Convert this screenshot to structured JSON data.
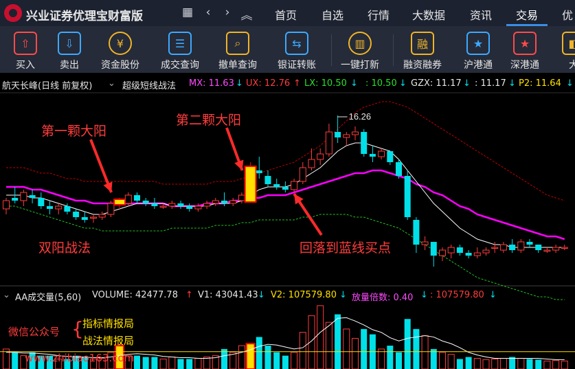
{
  "app": {
    "title": "兴业证券优理宝财富版"
  },
  "nav": {
    "grid_icon": "▦",
    "back_icon": "‹",
    "forward_icon": "›",
    "up_icon": "︽"
  },
  "menu": [
    "首页",
    "自选",
    "行情",
    "大数据",
    "资讯",
    "交易",
    "优"
  ],
  "toolbar": [
    {
      "label": "买入",
      "icon": "buy-icon",
      "glyph": "⇧",
      "color": "#ff4a4a"
    },
    {
      "label": "卖出",
      "icon": "sell-icon",
      "glyph": "⇩",
      "color": "#3da9ff"
    },
    {
      "label": "资金股份",
      "icon": "yuan-coin-icon",
      "glyph": "¥",
      "color": "#f0b429"
    },
    {
      "label": "成交查询",
      "icon": "list-icon",
      "glyph": "☰",
      "color": "#3da9ff"
    },
    {
      "label": "撤单查询",
      "icon": "search-doc-icon",
      "glyph": "⌕",
      "color": "#f0b429"
    },
    {
      "label": "银证转账",
      "icon": "transfer-icon",
      "glyph": "⇆",
      "color": "#3da9ff"
    },
    {
      "label": "一键打新",
      "icon": "new-stock-icon",
      "glyph": "▥",
      "color": "#f0b429"
    },
    {
      "label": "融资融券",
      "icon": "margin-icon",
      "glyph": "融",
      "color": "#f0b429"
    },
    {
      "label": "沪港通",
      "icon": "sh-hk-connect-icon",
      "glyph": "★",
      "color": "#3da9ff"
    },
    {
      "label": "深港通",
      "icon": "sz-hk-connect-icon",
      "glyph": "★",
      "color": "#ff4a4a"
    },
    {
      "label": "大",
      "icon": "more-icon",
      "glyph": "◧",
      "color": "#f0b429"
    }
  ],
  "info": {
    "stock": "航天长峰(日线 前复权)",
    "formula": "超级短线战法",
    "mx_label": "MX: 11.63",
    "mx_arrow": "↓",
    "ux_label": "UX: 12.76",
    "ux_arrow": "↑",
    "lx_label": "LX: 10.50",
    "lx_arrow": "↓",
    "c4_label": ": 10.50",
    "c4_arrow": "↓",
    "gzx_label": "GZX: 11.17",
    "gzx_arrow": "↓",
    "c6_label": ": 11.17",
    "c6_arrow": "↓",
    "p2_label": "P2: 11.64",
    "p2_arrow": "↓"
  },
  "annotations": {
    "first": "第一颗大阳",
    "second": "第二颗大阳",
    "strategy": "双阳战法",
    "pullback": "回落到蓝线买点",
    "high_label": "16.26"
  },
  "vol_info": {
    "name": "AA成交量(5,60)",
    "volume": "VOLUME: 42477.78",
    "volume_arrow": "↑",
    "v1": "V1: 43041.43",
    "v1_arrow": "↓",
    "v2": "V2: 107579.80",
    "v2_arrow": "↓",
    "ratio": "放量倍数: 0.40",
    "ratio_arrow": "↓",
    "last": ": 107579.80",
    "last_arrow": "↓"
  },
  "watermark": {
    "wechat": "微信公众号",
    "brace": "{",
    "line1": "指标情报局",
    "line2": "战法情报局",
    "url": "www.zhibiao163.com"
  },
  "colors": {
    "up": "#ff3c3c",
    "down": "#00e0e8",
    "highlight": "#ffe000",
    "ma_white": "#ffffff",
    "ma_magenta": "#ff00ff",
    "band_red": "#c00000",
    "band_green": "#20c020"
  },
  "chart_data": {
    "type": "candlestick",
    "candles": [
      {
        "o": 10.2,
        "h": 10.6,
        "l": 10.0,
        "c": 10.5
      },
      {
        "o": 10.6,
        "h": 11.0,
        "l": 10.4,
        "c": 10.5
      },
      {
        "o": 10.5,
        "h": 10.9,
        "l": 10.3,
        "c": 10.8
      },
      {
        "o": 10.7,
        "h": 10.9,
        "l": 10.4,
        "c": 10.6
      },
      {
        "o": 10.6,
        "h": 10.8,
        "l": 10.2,
        "c": 10.3
      },
      {
        "o": 10.3,
        "h": 10.5,
        "l": 10.0,
        "c": 10.2
      },
      {
        "o": 10.2,
        "h": 10.4,
        "l": 10.0,
        "c": 10.3
      },
      {
        "o": 10.3,
        "h": 10.4,
        "l": 10.0,
        "c": 10.1
      },
      {
        "o": 10.1,
        "h": 10.2,
        "l": 9.8,
        "c": 9.9
      },
      {
        "o": 9.9,
        "h": 10.1,
        "l": 9.7,
        "c": 9.8
      },
      {
        "o": 9.9,
        "h": 10.0,
        "l": 9.7,
        "c": 9.9
      },
      {
        "o": 9.9,
        "h": 10.1,
        "l": 9.8,
        "c": 10.0
      },
      {
        "o": 10.0,
        "h": 10.5,
        "l": 9.9,
        "c": 10.4
      },
      {
        "o": 10.5,
        "h": 10.6,
        "l": 10.2,
        "c": 10.4
      },
      {
        "o": 10.4,
        "h": 10.8,
        "l": 10.3,
        "c": 10.7
      },
      {
        "o": 10.7,
        "h": 10.8,
        "l": 10.4,
        "c": 10.5
      },
      {
        "o": 10.5,
        "h": 10.6,
        "l": 10.3,
        "c": 10.4
      },
      {
        "o": 10.4,
        "h": 10.6,
        "l": 10.2,
        "c": 10.3
      },
      {
        "o": 10.3,
        "h": 10.4,
        "l": 10.2,
        "c": 10.3
      },
      {
        "o": 10.3,
        "h": 10.5,
        "l": 10.2,
        "c": 10.4
      },
      {
        "o": 10.4,
        "h": 10.5,
        "l": 10.2,
        "c": 10.3
      },
      {
        "o": 10.3,
        "h": 10.4,
        "l": 10.1,
        "c": 10.2
      },
      {
        "o": 10.2,
        "h": 10.4,
        "l": 10.1,
        "c": 10.3
      },
      {
        "o": 10.3,
        "h": 10.5,
        "l": 10.2,
        "c": 10.4
      },
      {
        "o": 10.4,
        "h": 10.6,
        "l": 10.3,
        "c": 10.5
      },
      {
        "o": 10.5,
        "h": 10.8,
        "l": 10.3,
        "c": 10.4
      },
      {
        "o": 10.4,
        "h": 10.6,
        "l": 10.3,
        "c": 10.5
      },
      {
        "o": 10.5,
        "h": 10.8,
        "l": 10.4,
        "c": 10.7
      },
      {
        "o": 10.5,
        "h": 11.9,
        "l": 10.5,
        "c": 11.7
      },
      {
        "o": 11.6,
        "h": 12.1,
        "l": 11.3,
        "c": 11.5
      },
      {
        "o": 11.4,
        "h": 11.6,
        "l": 11.0,
        "c": 11.1
      },
      {
        "o": 11.1,
        "h": 11.3,
        "l": 10.9,
        "c": 11.0
      },
      {
        "o": 11.0,
        "h": 11.2,
        "l": 10.8,
        "c": 10.9
      },
      {
        "o": 10.9,
        "h": 11.3,
        "l": 10.8,
        "c": 11.2
      },
      {
        "o": 11.2,
        "h": 11.9,
        "l": 11.1,
        "c": 11.7
      },
      {
        "o": 11.7,
        "h": 12.4,
        "l": 11.6,
        "c": 12.0
      },
      {
        "o": 12.0,
        "h": 12.4,
        "l": 11.8,
        "c": 12.2
      },
      {
        "o": 12.2,
        "h": 13.3,
        "l": 12.1,
        "c": 13.0
      },
      {
        "o": 13.0,
        "h": 13.6,
        "l": 12.6,
        "c": 12.8
      },
      {
        "o": 12.8,
        "h": 13.0,
        "l": 12.5,
        "c": 12.9
      },
      {
        "o": 12.9,
        "h": 13.2,
        "l": 12.7,
        "c": 13.0
      },
      {
        "o": 13.0,
        "h": 13.1,
        "l": 12.1,
        "c": 12.2
      },
      {
        "o": 12.2,
        "h": 12.5,
        "l": 11.9,
        "c": 12.1
      },
      {
        "o": 12.1,
        "h": 12.4,
        "l": 12.0,
        "c": 12.3
      },
      {
        "o": 12.3,
        "h": 12.3,
        "l": 11.8,
        "c": 11.9
      },
      {
        "o": 11.9,
        "h": 12.0,
        "l": 11.3,
        "c": 11.4
      },
      {
        "o": 11.4,
        "h": 11.6,
        "l": 9.8,
        "c": 9.9
      },
      {
        "o": 9.8,
        "h": 9.9,
        "l": 8.6,
        "c": 8.9
      },
      {
        "o": 8.9,
        "h": 9.2,
        "l": 8.7,
        "c": 9.0
      },
      {
        "o": 9.0,
        "h": 9.0,
        "l": 8.1,
        "c": 8.5
      },
      {
        "o": 8.5,
        "h": 8.8,
        "l": 8.3,
        "c": 8.7
      },
      {
        "o": 8.6,
        "h": 8.9,
        "l": 8.4,
        "c": 8.8
      },
      {
        "o": 8.8,
        "h": 8.9,
        "l": 8.5,
        "c": 8.6
      },
      {
        "o": 8.6,
        "h": 8.7,
        "l": 8.4,
        "c": 8.5
      },
      {
        "o": 8.5,
        "h": 8.8,
        "l": 8.4,
        "c": 8.6
      },
      {
        "o": 8.6,
        "h": 8.8,
        "l": 8.5,
        "c": 8.7
      },
      {
        "o": 8.8,
        "h": 9.0,
        "l": 8.6,
        "c": 8.8
      },
      {
        "o": 8.7,
        "h": 9.0,
        "l": 8.6,
        "c": 8.9
      },
      {
        "o": 8.9,
        "h": 9.1,
        "l": 8.6,
        "c": 8.7
      },
      {
        "o": 8.7,
        "h": 9.1,
        "l": 8.6,
        "c": 9.0
      },
      {
        "o": 9.0,
        "h": 9.1,
        "l": 8.8,
        "c": 8.9
      },
      {
        "o": 8.9,
        "h": 8.9,
        "l": 8.6,
        "c": 8.7
      },
      {
        "o": 8.7,
        "h": 8.8,
        "l": 8.6,
        "c": 8.7
      },
      {
        "o": 8.7,
        "h": 8.9,
        "l": 8.6,
        "c": 8.8
      },
      {
        "o": 8.8,
        "h": 8.9,
        "l": 8.7,
        "c": 8.8
      }
    ],
    "highlight_indices": [
      13,
      28
    ],
    "ma_white": [
      10.7,
      10.7,
      10.7,
      10.6,
      10.6,
      10.5,
      10.4,
      10.3,
      10.2,
      10.1,
      10.0,
      10.0,
      10.1,
      10.2,
      10.3,
      10.4,
      10.4,
      10.4,
      10.4,
      10.3,
      10.3,
      10.3,
      10.3,
      10.3,
      10.4,
      10.4,
      10.4,
      10.5,
      10.7,
      10.9,
      11.0,
      11.0,
      11.0,
      11.1,
      11.3,
      11.5,
      11.7,
      12.0,
      12.3,
      12.5,
      12.6,
      12.6,
      12.5,
      12.4,
      12.3,
      12.0,
      11.6,
      11.2,
      10.8,
      10.4,
      10.1,
      9.8,
      9.5,
      9.3,
      9.1,
      9.0,
      8.9,
      8.9,
      8.8,
      8.8,
      8.8,
      8.8,
      8.8,
      8.8,
      8.8
    ],
    "ma_magenta": [
      11.0,
      11.0,
      11.0,
      10.9,
      10.9,
      10.8,
      10.7,
      10.6,
      10.5,
      10.5,
      10.4,
      10.4,
      10.4,
      10.4,
      10.4,
      10.4,
      10.4,
      10.4,
      10.4,
      10.3,
      10.3,
      10.3,
      10.3,
      10.4,
      10.4,
      10.4,
      10.5,
      10.5,
      10.6,
      10.6,
      10.7,
      10.7,
      10.7,
      10.8,
      10.9,
      11.0,
      11.1,
      11.2,
      11.3,
      11.4,
      11.5,
      11.5,
      11.6,
      11.6,
      11.5,
      11.4,
      11.3,
      11.1,
      11.0,
      10.8,
      10.7,
      10.5,
      10.3,
      10.2,
      10.0,
      9.9,
      9.8,
      9.7,
      9.6,
      9.5,
      9.4,
      9.3,
      9.2,
      9.2,
      9.1
    ],
    "band_upper": [
      11.7,
      11.7,
      11.7,
      11.6,
      11.5,
      11.5,
      11.4,
      11.3,
      11.3,
      11.2,
      11.2,
      11.2,
      11.2,
      11.2,
      11.2,
      11.2,
      11.2,
      11.2,
      11.1,
      11.1,
      11.1,
      11.1,
      11.1,
      11.1,
      11.2,
      11.2,
      11.2,
      11.3,
      11.4,
      11.5,
      11.6,
      11.7,
      11.8,
      11.9,
      12.1,
      12.3,
      12.5,
      12.8,
      13.1,
      13.4,
      13.7,
      13.9,
      14.0,
      14.1,
      14.1,
      14.0,
      13.9,
      13.7,
      13.5,
      13.3,
      13.1,
      12.9,
      12.7,
      12.5,
      12.3,
      12.1,
      11.9,
      11.7,
      11.5,
      11.3,
      11.1,
      10.9,
      10.7,
      10.6,
      10.5
    ],
    "band_lower": [
      10.3,
      10.3,
      10.2,
      10.1,
      10.0,
      9.9,
      9.8,
      9.7,
      9.6,
      9.5,
      9.5,
      9.4,
      9.4,
      9.4,
      9.4,
      9.4,
      9.4,
      9.4,
      9.4,
      9.5,
      9.5,
      9.5,
      9.5,
      9.5,
      9.6,
      9.6,
      9.6,
      9.7,
      9.7,
      9.8,
      9.8,
      9.8,
      9.8,
      9.8,
      9.9,
      9.9,
      10.0,
      10.0,
      10.0,
      10.0,
      9.9,
      9.9,
      9.8,
      9.7,
      9.6,
      9.5,
      9.3,
      9.1,
      8.9,
      8.7,
      8.5,
      8.3,
      8.1,
      7.9,
      7.7,
      7.6,
      7.5,
      7.4,
      7.3,
      7.2,
      7.1,
      7.0,
      7.0,
      6.9,
      6.9
    ],
    "volume": [
      3,
      2.5,
      2,
      2.5,
      2,
      2,
      1.5,
      1.5,
      2,
      1.8,
      1.5,
      1.6,
      2.5,
      3.5,
      2,
      2,
      1.8,
      1.8,
      1.5,
      1.8,
      1.5,
      1.5,
      1.6,
      1.8,
      2,
      3,
      2.5,
      3.5,
      3.8,
      4.8,
      3.5,
      2.5,
      2,
      2.5,
      5.5,
      8,
      9.5,
      7,
      8.2,
      6,
      4.6,
      6,
      5.2,
      3,
      3.5,
      2.5,
      7.5,
      6,
      5,
      3,
      2.5,
      2.2,
      1.5,
      1.8,
      1.6,
      1.4,
      1.5,
      1.6,
      1.8,
      1.6,
      1.5,
      1.4,
      1.2,
      1.3,
      1.2
    ],
    "vol_ma": [
      2.5,
      2.5,
      2.4,
      2.4,
      2.3,
      2.2,
      2.0,
      1.9,
      1.8,
      1.8,
      1.7,
      1.7,
      1.8,
      2.0,
      2.2,
      2.3,
      2.2,
      2.1,
      1.9,
      1.8,
      1.7,
      1.7,
      1.6,
      1.6,
      1.7,
      2.0,
      2.2,
      2.5,
      2.9,
      3.4,
      3.7,
      3.6,
      3.3,
      3.0,
      3.2,
      4.2,
      5.5,
      6.5,
      7.6,
      7.7,
      7.2,
      6.6,
      5.9,
      5.5,
      4.7,
      4.2,
      4.6,
      4.8,
      5.0,
      4.8,
      4.2,
      3.8,
      3.2,
      2.5,
      2.1,
      1.8,
      1.6,
      1.6,
      1.6,
      1.6,
      1.6,
      1.6,
      1.5,
      1.4,
      1.4
    ],
    "vol_ma_long": 2.6,
    "price_range": [
      7.8,
      14.3
    ],
    "volume_range": [
      0,
      10
    ]
  }
}
